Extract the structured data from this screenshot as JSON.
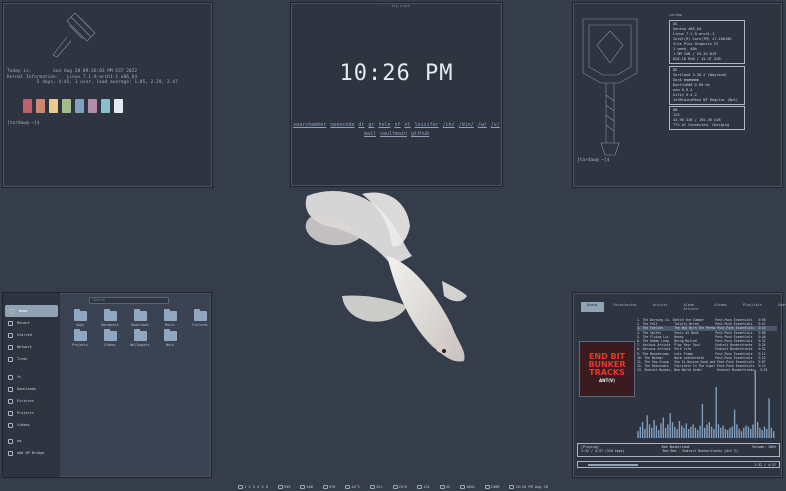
{
  "neofetch_left": {
    "prompt": "[tardaw@ ~]$",
    "lines": [
      "Today is:        Sun Aug 28 09:26:03 PM EST 2022",
      "Kernel Information:   Linux 7.1.9-arch1-1 x86_64",
      "           5 days, 4:45, 1 user, load average: 1.05, 2.29, 2.47"
    ],
    "swatches": [
      "#bf616a",
      "#d08770",
      "#ebcb8b",
      "#a3be8c",
      "#81a1c1",
      "#b48ead",
      "#88c0d0",
      "#e5e9f0"
    ]
  },
  "clock": {
    "title": "~ : tty-clock",
    "time": "10:26 PM",
    "links_row1": [
      "searchember",
      "opencode",
      "dr",
      "gr",
      "hole",
      "nf",
      "vt",
      "leisifer",
      "/ch/",
      "/din/",
      "/w/",
      "/v/"
    ],
    "links_row2": [
      "mail",
      "vaultmain",
      "github"
    ]
  },
  "neofetch_right": {
    "user": "tardaw",
    "prompt": "[tardaw@ ~]$",
    "box1_title": "OS",
    "box1": [
      "Gentoo x86_64",
      "Linux 7.1.9-arch1-1",
      "Intel(R) Core(TM) i7-10610U",
      "Iris Plus Graphics G7",
      "1 week, 48h",
      "1.9M SGB / 55.3G B19",
      "620.16 MiB / 15.4T GiB"
    ],
    "box2_title": "DE",
    "box2": [
      "Vortland 3.36.2 (Wayland)",
      "Dock mmmmmmm",
      "Dunfn1600 @ 60 Hz",
      "wnm 9.9.2",
      "kitty 0.4.2",
      "JetBrainsMono NF Regular (8pt)"
    ],
    "box3_title": "HW",
    "box3": [
      "123",
      "44.96 GiB / 195.46 GiB",
      "77% AC Connected, Charging"
    ]
  },
  "files": {
    "sidebar": [
      {
        "label": "Home",
        "active": true
      },
      {
        "label": "Recent",
        "active": false
      },
      {
        "label": "Starred",
        "active": false
      },
      {
        "label": "Network",
        "active": false
      },
      {
        "label": "Trash",
        "active": false
      },
      {
        "label": "fs",
        "active": false
      },
      {
        "label": "Downloads",
        "active": false
      },
      {
        "label": "Pictures",
        "active": false
      },
      {
        "label": "Projects",
        "active": false
      },
      {
        "label": "Videos",
        "active": false
      },
      {
        "label": "vm",
        "active": false
      },
      {
        "label": "Add VM Bridge",
        "active": false
      }
    ],
    "search_placeholder": "Search",
    "folders": [
      "Apps",
      "Documents",
      "Downloads",
      "Music",
      "Pictures",
      "Projects",
      "Videos",
      "Wallpapers",
      "Work"
    ]
  },
  "music": {
    "tabs": [
      "Queue",
      "Directories",
      "Artists",
      "Album Artists",
      "Albums",
      "Playlists",
      "Search"
    ],
    "active_tab": "Queue",
    "album_text": [
      "END BIT",
      "BUNKER",
      "TRACKS",
      "ANT(V)"
    ],
    "tracks": [
      "1. The Burning Co. Sketch the Summer      Post-Punk Essentials   3:56",
      "2. The Fall         Totally Wired         Post-Punk Essentials   3:41",
      "3. The Feelies      The Boy With The Perma Post-Punk Essentials  3:16",
      "4. The Smiths       Panic At Bank         Post-Punk Essentials   3:08",
      "5. The Flying Liz.  Money                 Post-Punk Essentials   3:40",
      "6. The Human Leag.  Being Boiled          Post-Punk Essentials   3:31",
      "7. Various Artists  Play Your Soul        Endroit Bunkertracks   3:24",
      "8. Various Artists  Pole life             Endroit Bunkertracks   4:32",
      "9. The Monochrome.  Lets Frame            Post-Punk Essentials   3:11",
      "10. The Normal      Warm Leatherette      Post-Punk Essentials   3:22",
      "11. The Pop Group   She Is Beyond Good and Post-Punk Essentials  3:07",
      "12. The Raincoats   Fairytale In The Super Post-Punk Essentials  3:12",
      "13. Endroit Bunker, New World Order        Endroit Bunkertracks   3:52"
    ],
    "bars": [
      6,
      10,
      14,
      8,
      20,
      12,
      9,
      16,
      11,
      7,
      13,
      18,
      9,
      12,
      22,
      14,
      10,
      8,
      15,
      11,
      9,
      13,
      8,
      10,
      12,
      9,
      7,
      11,
      30,
      9,
      12,
      14,
      10,
      8,
      45,
      12,
      9,
      11,
      8,
      7,
      9,
      10,
      25,
      12,
      8,
      6,
      9,
      11,
      10,
      8,
      12,
      60,
      14,
      9,
      7,
      10,
      8,
      35,
      9,
      6
    ],
    "status_state": "[Playing]",
    "status_time": "1:32 / 4:37 (320 kbps)",
    "status_song": "Bee Bunkerland",
    "status_album": "Bee Bee - Endroit Bunkertracks [Act V]",
    "status_volume": "Volume: 100%",
    "progress": "1:32 / 4:37",
    "progress_fraction": 0.33
  },
  "bar": {
    "items": [
      "1",
      "2",
      "3",
      "4",
      "5",
      "6",
      "949",
      "108",
      "978",
      "44°C",
      "32%",
      "25/6",
      "131",
      "32",
      "100%",
      "2400",
      "10:26 PM",
      "Aug 28"
    ]
  }
}
